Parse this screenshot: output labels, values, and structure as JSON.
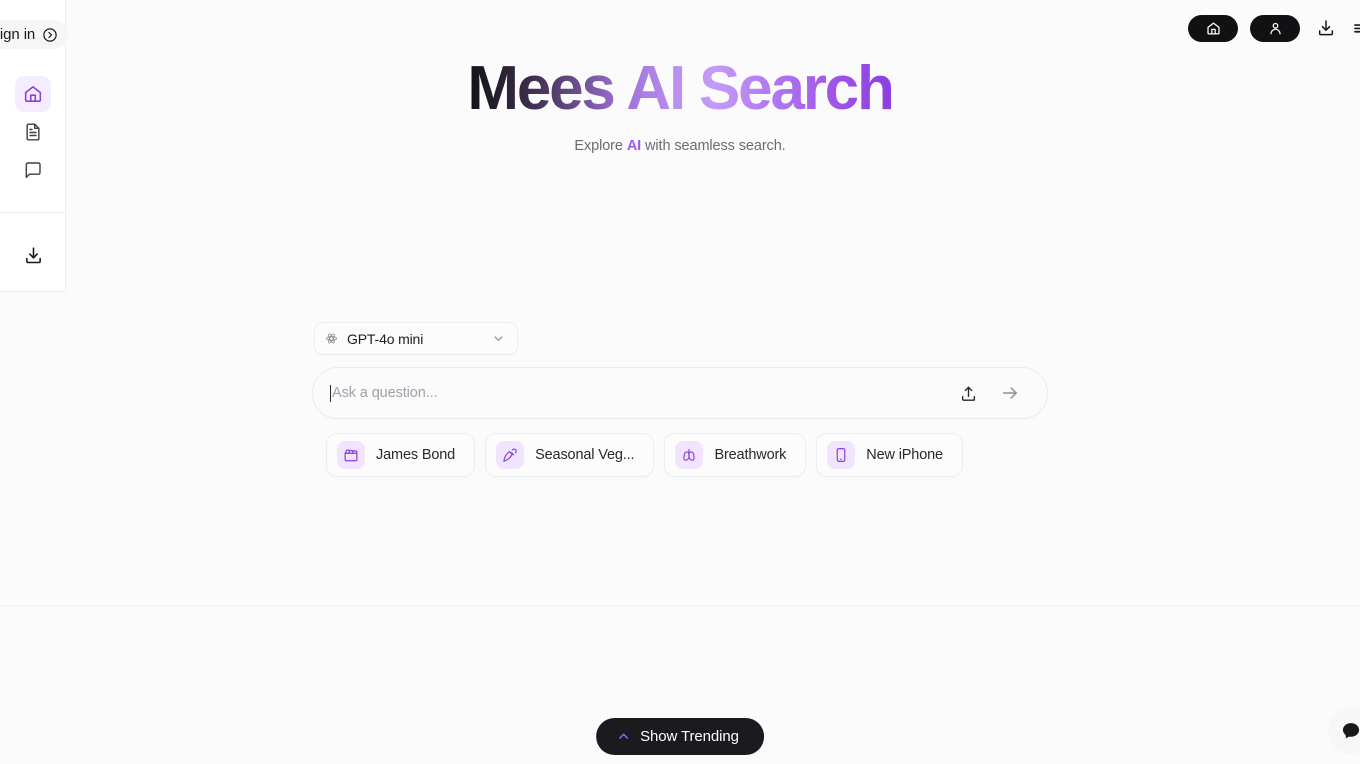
{
  "window": {
    "background_color": "#fbfbfc"
  },
  "signin": {
    "label": "Sign in",
    "icon": "arrow-circle-right-icon"
  },
  "sidebar": {
    "items": [
      {
        "name": "home",
        "icon": "home-icon",
        "active": true
      },
      {
        "name": "documents",
        "icon": "file-text-icon",
        "active": false
      },
      {
        "name": "chat",
        "icon": "message-square-icon",
        "active": false
      }
    ],
    "bottom_item": {
      "name": "install",
      "icon": "download-icon"
    },
    "accent_color": "#8b3ede",
    "active_background": "#f5edff"
  },
  "topbar": {
    "buttons": [
      {
        "name": "home",
        "icon": "home-icon",
        "style": "dark-pill"
      },
      {
        "name": "account",
        "icon": "user-icon",
        "style": "dark-pill"
      },
      {
        "name": "install-app",
        "icon": "download-icon",
        "style": "plain"
      },
      {
        "name": "more",
        "icon": "more-icon",
        "style": "plain"
      }
    ],
    "pill_color": "#111113"
  },
  "hero": {
    "title_plain": "Mees AI Search",
    "title_parts": [
      {
        "text": "Mees ",
        "tone": "dark"
      },
      {
        "text": "AI Search",
        "tone": "purple"
      }
    ],
    "subtitle_before": "Explore ",
    "subtitle_highlight": "AI",
    "subtitle_after": " with seamless search.",
    "gradient_start": "#121214",
    "gradient_end": "#8b3ede"
  },
  "model_selector": {
    "icon": "openai-logo-icon",
    "value": "GPT-4o mini",
    "chevron": "chevron-down-icon"
  },
  "search": {
    "value": "",
    "placeholder": "Ask a question...",
    "cursor_visible": true,
    "upload_icon": "upload-icon",
    "submit_icon": "arrow-right-icon"
  },
  "suggestions": [
    {
      "label": "James Bond",
      "icon": "clapperboard-icon"
    },
    {
      "label": "Seasonal Veg...",
      "icon": "carrot-icon"
    },
    {
      "label": "Breathwork",
      "icon": "lungs-icon"
    },
    {
      "label": "New iPhone",
      "icon": "smartphone-icon"
    }
  ],
  "trending": {
    "label": "Show Trending",
    "icon": "chevron-up-icon",
    "icon_color": "#9b5cf0",
    "background": "#1b1b1f"
  },
  "help": {
    "icon": "chat-help-icon"
  }
}
